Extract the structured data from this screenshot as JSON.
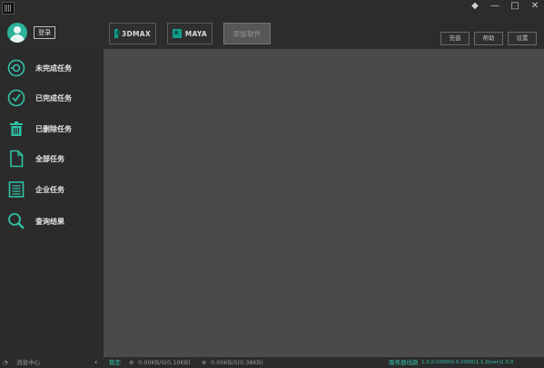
{
  "titlebar": {
    "logo_icon": "grid-logo-icon",
    "window_controls": [
      "◆",
      "—",
      "□",
      "✕"
    ]
  },
  "user": {
    "avatar_icon": "user-avatar-icon",
    "login_label": "登录"
  },
  "software_tabs": [
    {
      "label": "3DMAX",
      "icon": "3dsmax-logo-icon"
    },
    {
      "label": "MAYA",
      "icon": "maya-logo-icon"
    },
    {
      "label": "添加软件",
      "icon": ""
    }
  ],
  "top_buttons": [
    "充值",
    "帮助",
    "设置"
  ],
  "sidebar": {
    "items": [
      {
        "label": "未完成任务",
        "icon": "pending-task-icon"
      },
      {
        "label": "已完成任务",
        "icon": "completed-check-icon"
      },
      {
        "label": "已删除任务",
        "icon": "trash-icon"
      },
      {
        "label": "全部任务",
        "icon": "document-icon"
      },
      {
        "label": "企业任务",
        "icon": "list-document-icon"
      },
      {
        "label": "查询结果",
        "icon": "search-icon"
      }
    ]
  },
  "statusbar": {
    "left_text": "消息中心",
    "collapse_arrow": "‹",
    "status_label": "稳定",
    "upload_speed": "0.00KB/S(0.10KB)",
    "download_speed": "0.00KB/S(0.38KB)",
    "right_accent": "服务器线路",
    "version": "1.0.0.0000(0.0.0000)1 1.0(ver)2.0.0"
  },
  "colors": {
    "accent": "#30c2a6",
    "sidebar_bg": "#2b2b2b",
    "main_bg": "#4a4a4a"
  }
}
